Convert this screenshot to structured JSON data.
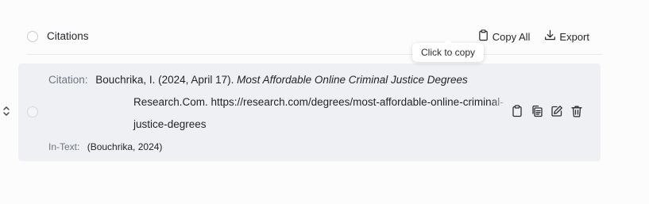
{
  "header": {
    "title": "Citations",
    "copy_all_label": "Copy All",
    "export_label": "Export"
  },
  "tooltip": {
    "text": "Click to copy"
  },
  "citation": {
    "label": "Citation:",
    "before_title": "Bouchrika, I. (2024, April 17). ",
    "title": "Most Affordable Online Criminal Justice Degrees",
    "line2": "Research.Com. https://research.com/degrees/most-affordable-online-criminal-",
    "line3": "justice-degrees",
    "intext_label": "In-Text:",
    "intext_value": "(Bouchrika, 2024)"
  },
  "icons": {
    "copy_all": "clipboard-icon",
    "export": "download-icon",
    "row_copy": "clipboard-icon",
    "row_duplicate": "copy-icon",
    "row_edit": "edit-icon",
    "row_delete": "trash-icon",
    "expand": "chevron-up-down-icon"
  }
}
